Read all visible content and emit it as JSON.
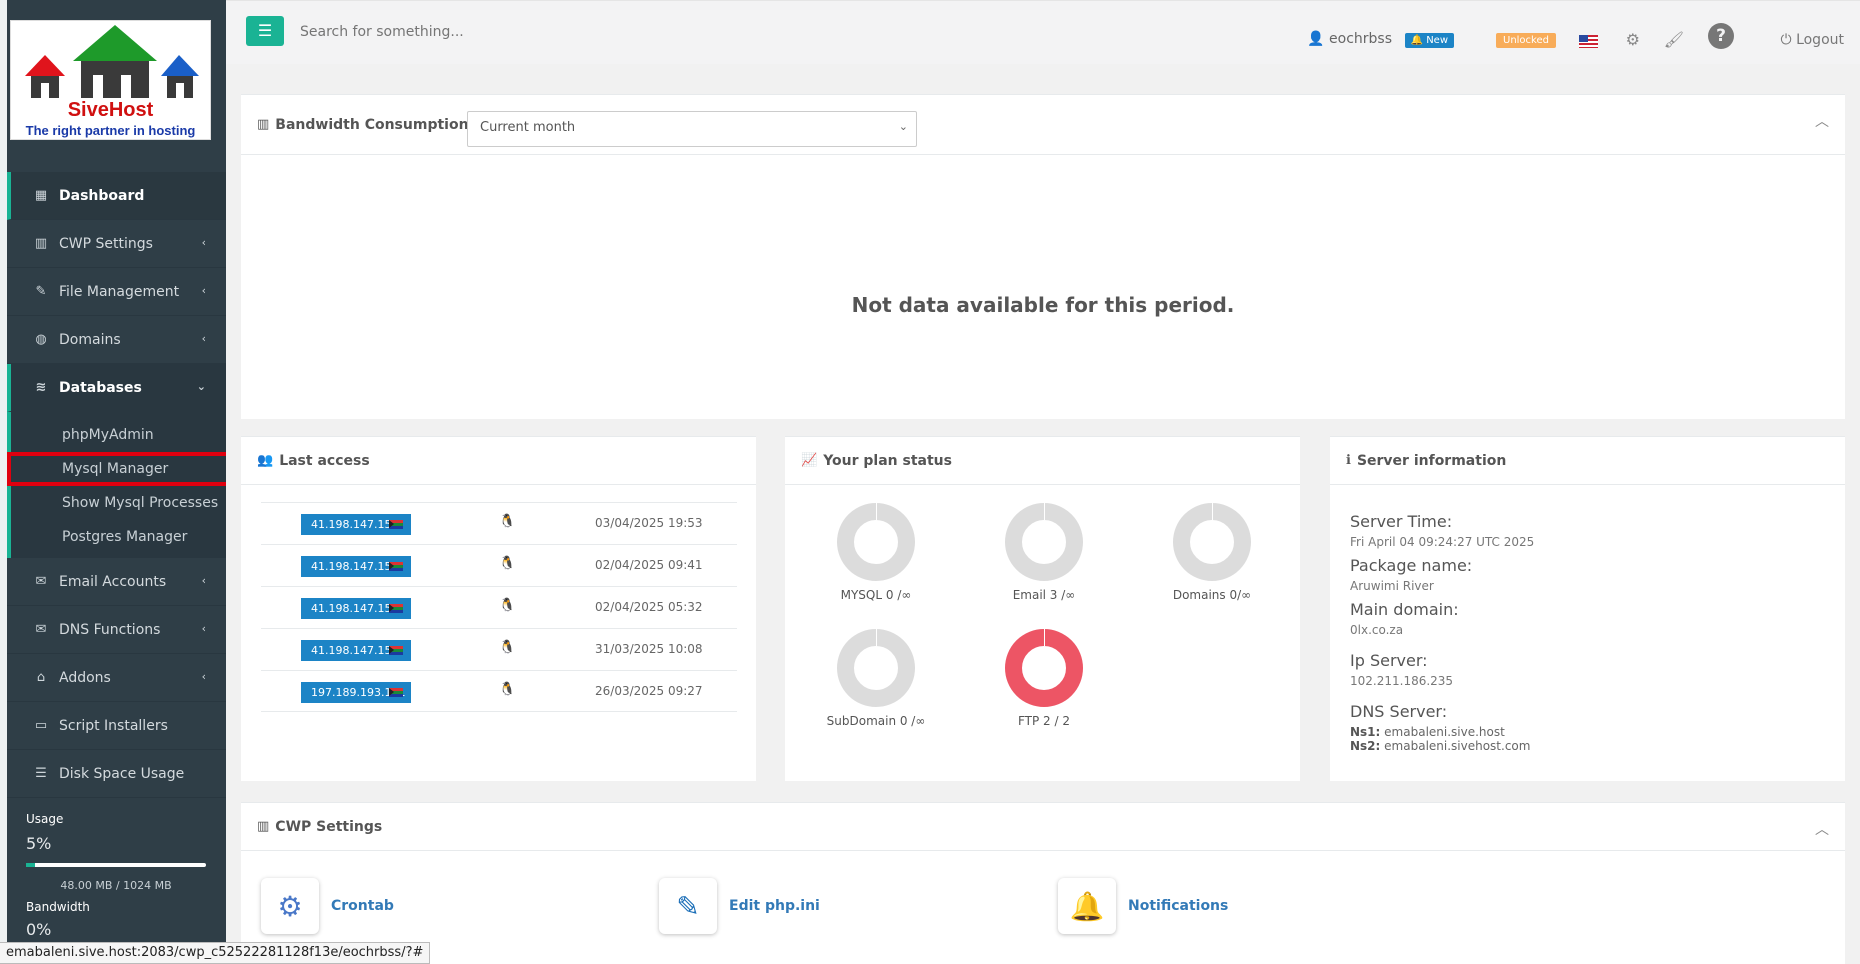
{
  "logo": {
    "brand": "SiveHost",
    "tagline": "The right partner in hosting"
  },
  "sidebar": {
    "items": [
      {
        "label": "Dashboard",
        "icon": "dashboard-icon"
      },
      {
        "label": "CWP Settings",
        "icon": "bar-chart-icon"
      },
      {
        "label": "File Management",
        "icon": "edit-icon"
      },
      {
        "label": "Domains",
        "icon": "globe-icon"
      },
      {
        "label": "Databases",
        "icon": "database-icon"
      },
      {
        "label": "Email Accounts",
        "icon": "envelope-icon"
      },
      {
        "label": "DNS Functions",
        "icon": "envelope-icon"
      },
      {
        "label": "Addons",
        "icon": "bank-icon"
      },
      {
        "label": "Script Installers",
        "icon": "desktop-icon"
      },
      {
        "label": "Disk Space Usage",
        "icon": "list-icon"
      }
    ],
    "databases_sub": [
      "phpMyAdmin",
      "Mysql Manager",
      "Show Mysql Processes",
      "Postgres Manager"
    ],
    "usage": {
      "label": "Usage",
      "percent": "5%",
      "fraction": 0.05,
      "detail": "48.00 MB / 1024 MB",
      "bandwidth_label": "Bandwidth",
      "bandwidth_percent": "0%"
    }
  },
  "topbar": {
    "search_placeholder": "Search for something...",
    "username": "eochrbss",
    "new_badge": "New",
    "unlocked_badge": "Unlocked",
    "logout": "Logout"
  },
  "bandwidth": {
    "title": "Bandwidth Consumption",
    "period": "Current month",
    "message": "Not data available for this period."
  },
  "last_access": {
    "title": "Last access",
    "rows": [
      {
        "ip": "41.198.147.15",
        "date": "03/04/2025 19:53"
      },
      {
        "ip": "41.198.147.15",
        "date": "02/04/2025 09:41"
      },
      {
        "ip": "41.198.147.15",
        "date": "02/04/2025 05:32"
      },
      {
        "ip": "41.198.147.15",
        "date": "31/03/2025 10:08"
      },
      {
        "ip": "197.189.193.191",
        "date": "26/03/2025 09:27"
      }
    ]
  },
  "plan": {
    "title": "Your plan status",
    "items": [
      {
        "label": "MYSQL 0 /∞",
        "used_fraction": 0
      },
      {
        "label": "Email 3 /∞",
        "used_fraction": 0
      },
      {
        "label": "Domains 0/∞",
        "used_fraction": 0
      },
      {
        "label": "SubDomain 0 /∞",
        "used_fraction": 0
      },
      {
        "label": "FTP 2 / 2",
        "used_fraction": 1
      }
    ]
  },
  "server": {
    "title": "Server information",
    "time_label": "Server Time:",
    "time": "Fri April 04 09:24:27 UTC 2025",
    "package_label": "Package name:",
    "package": "Aruwimi River",
    "domain_label": "Main domain:",
    "domain": "0lx.co.za",
    "ip_label": "Ip Server:",
    "ip": "102.211.186.235",
    "dns_label": "DNS Server:",
    "ns1_label": "Ns1:",
    "ns1": "emabaleni.sive.host",
    "ns2_label": "Ns2:",
    "ns2": "emabaleni.sivehost.com"
  },
  "cwp_settings": {
    "title": "CWP Settings",
    "items": [
      "Crontab",
      "Edit php.ini",
      "Notifications"
    ]
  },
  "statusbar": "emabaleni.sive.host:2083/cwp_c52522281128f13e/eochrbss/?#",
  "colors": {
    "accent": "#1ab394",
    "primary": "#1c84c6",
    "danger": "#ed5565",
    "warning": "#f8ac59",
    "sidebar": "#2f3e47"
  }
}
